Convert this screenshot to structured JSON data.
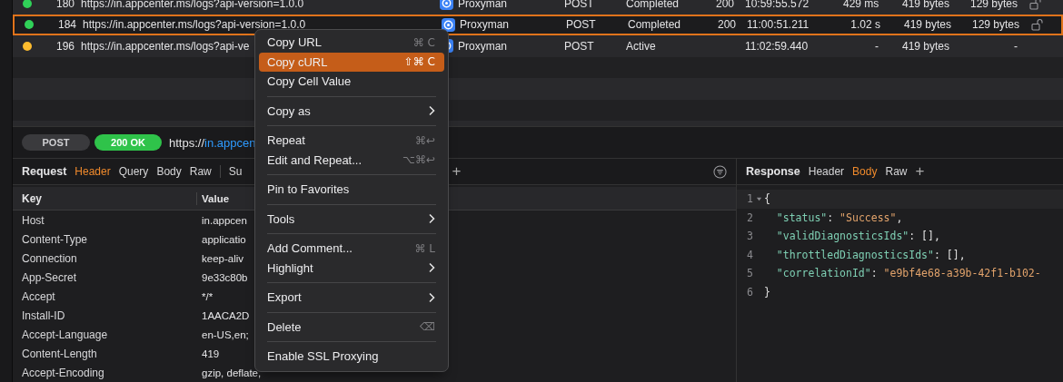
{
  "requests": {
    "rows": [
      {
        "color": "#30d158",
        "id": "180",
        "url": "https://in.appcenter.ms/logs?api-version=1.0.0",
        "app": "Proxyman",
        "method": "POST",
        "status": "Completed",
        "code": "200",
        "time": "10:59:55.572",
        "duration": "429 ms",
        "request_size": "419 bytes",
        "response_size": "129 bytes",
        "lock": true,
        "selected": false
      },
      {
        "color": "#30d158",
        "id": "184",
        "url": "https://in.appcenter.ms/logs?api-version=1.0.0",
        "app": "Proxyman",
        "method": "POST",
        "status": "Completed",
        "code": "200",
        "time": "11:00:51.211",
        "duration": "1.02 s",
        "request_size": "419 bytes",
        "response_size": "129 bytes",
        "lock": true,
        "selected": true
      },
      {
        "color": "#febc2e",
        "id": "196",
        "url": "https://in.appcenter.ms/logs?api-ve",
        "app": "Proxyman",
        "method": "POST",
        "status": "Active",
        "time": "11:02:59.440",
        "duration": "-",
        "request_size": "419 bytes",
        "response_size": "-",
        "lock": false,
        "selected": false
      }
    ]
  },
  "url_bar": {
    "method": "POST",
    "status": "200 OK",
    "scheme": "https://",
    "host": "in.appcen"
  },
  "request": {
    "title": "Request",
    "tabs": [
      {
        "label": "Header",
        "selected": true
      },
      {
        "label": "Query",
        "selected": false
      },
      {
        "label": "Body",
        "selected": false
      },
      {
        "label": "Raw",
        "selected": false
      },
      {
        "label": "Su",
        "selected": false
      }
    ],
    "add": "+",
    "columns": [
      "Key",
      "Value"
    ],
    "headers": [
      {
        "key": "Host",
        "value": "in.appcen"
      },
      {
        "key": "Content-Type",
        "value": "applicatio"
      },
      {
        "key": "Connection",
        "value": "keep-aliv"
      },
      {
        "key": "App-Secret",
        "value": "9e33c80b"
      },
      {
        "key": "Accept",
        "value": "*/*"
      },
      {
        "key": "Install-ID",
        "value": "1AACA2D"
      },
      {
        "key": "Accept-Language",
        "value": "en-US,en;"
      },
      {
        "key": "Content-Length",
        "value": "419"
      },
      {
        "key": "Accept-Encoding",
        "value": "gzip, deflate,"
      }
    ]
  },
  "response": {
    "title": "Response",
    "tabs": [
      {
        "label": "Header",
        "selected": false
      },
      {
        "label": "Body",
        "selected": true
      },
      {
        "label": "Raw",
        "selected": false
      }
    ],
    "add": "+",
    "lines": [
      {
        "number": "1",
        "foldable": true,
        "highlighted": true,
        "tokens": [
          {
            "kind": "punct",
            "text": "{"
          }
        ]
      },
      {
        "number": "2",
        "foldable": false,
        "highlighted": false,
        "tokens": [
          {
            "kind": "key",
            "text": "  \"status\""
          },
          {
            "kind": "punct",
            "text": ": "
          },
          {
            "kind": "string",
            "text": "\"Success\""
          },
          {
            "kind": "punct",
            "text": ","
          }
        ]
      },
      {
        "number": "3",
        "foldable": false,
        "highlighted": false,
        "tokens": [
          {
            "kind": "key",
            "text": "  \"validDiagnosticsIds\""
          },
          {
            "kind": "punct",
            "text": ": [],"
          }
        ]
      },
      {
        "number": "4",
        "foldable": false,
        "highlighted": false,
        "tokens": [
          {
            "kind": "key",
            "text": "  \"throttledDiagnosticsIds\""
          },
          {
            "kind": "punct",
            "text": ": [],"
          }
        ]
      },
      {
        "number": "5",
        "foldable": false,
        "highlighted": false,
        "tokens": [
          {
            "kind": "key",
            "text": "  \"correlationId\""
          },
          {
            "kind": "punct",
            "text": ": "
          },
          {
            "kind": "string",
            "text": "\"e9bf4e68-a39b-42f1-b102-"
          }
        ]
      },
      {
        "number": "6",
        "foldable": false,
        "highlighted": false,
        "tokens": [
          {
            "kind": "punct",
            "text": "}"
          }
        ]
      }
    ]
  },
  "context_menu": {
    "items": [
      {
        "kind": "item",
        "label": "Copy URL",
        "shortcut": "⌘ C",
        "submenu": false,
        "selected": false
      },
      {
        "kind": "item",
        "label": "Copy cURL",
        "shortcut": "⇧⌘ C",
        "submenu": false,
        "selected": true
      },
      {
        "kind": "item",
        "label": "Copy Cell Value",
        "submenu": false,
        "selected": false
      },
      {
        "kind": "divider"
      },
      {
        "kind": "item",
        "label": "Copy as",
        "submenu": true,
        "selected": false
      },
      {
        "kind": "divider"
      },
      {
        "kind": "item",
        "label": "Repeat",
        "shortcut": "⌘↩",
        "submenu": false,
        "selected": false
      },
      {
        "kind": "item",
        "label": "Edit and Repeat...",
        "shortcut": "⌥⌘↩",
        "submenu": false,
        "selected": false
      },
      {
        "kind": "divider"
      },
      {
        "kind": "item",
        "label": "Pin to Favorites",
        "submenu": false,
        "selected": false
      },
      {
        "kind": "divider"
      },
      {
        "kind": "item",
        "label": "Tools",
        "submenu": true,
        "selected": false
      },
      {
        "kind": "divider"
      },
      {
        "kind": "item",
        "label": "Add Comment...",
        "shortcut": "⌘ L",
        "submenu": false,
        "selected": false
      },
      {
        "kind": "item",
        "label": "Highlight",
        "submenu": true,
        "selected": false
      },
      {
        "kind": "divider"
      },
      {
        "kind": "item",
        "label": "Export",
        "submenu": true,
        "selected": false
      },
      {
        "kind": "divider"
      },
      {
        "kind": "item",
        "label": "Delete",
        "shortcut": "⌫",
        "submenu": false,
        "selected": false
      },
      {
        "kind": "divider"
      },
      {
        "kind": "item",
        "label": "Enable SSL Proxying",
        "submenu": false,
        "selected": false
      }
    ]
  }
}
